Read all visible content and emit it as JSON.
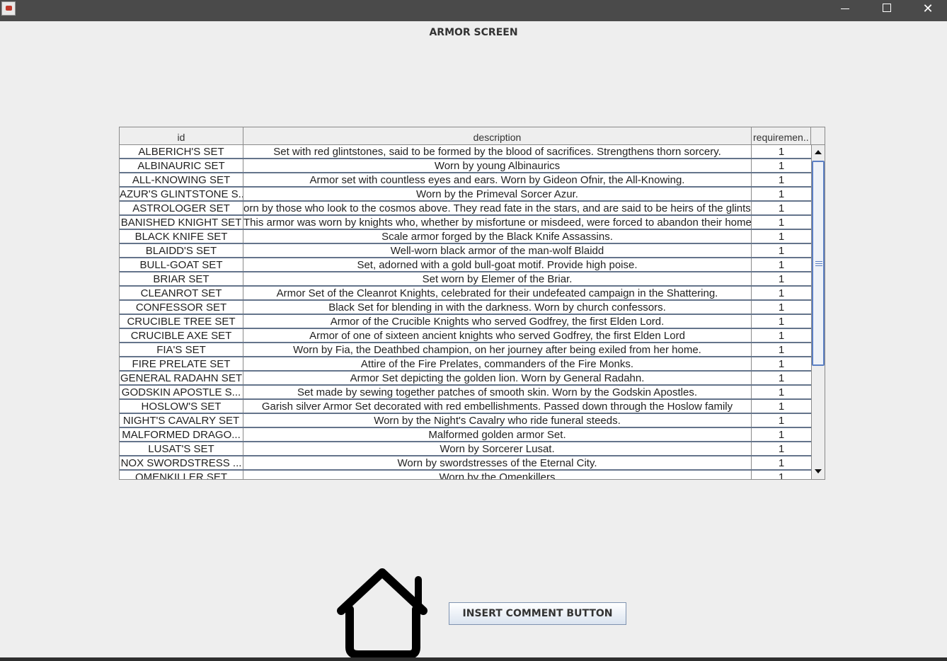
{
  "window": {
    "minimize_glyph": "",
    "maximize_glyph": "",
    "close_glyph": "✕"
  },
  "screen": {
    "title": "ARMOR SCREEN"
  },
  "table": {
    "columns": [
      "id",
      "description",
      "requiremen.."
    ],
    "rows": [
      {
        "id": "ALBERICH'S SET",
        "description": "Set with red glintstones, said to be formed by the blood of sacrifices. Strengthens thorn sorcery.",
        "req": "1"
      },
      {
        "id": "ALBINAURIC SET",
        "description": "Worn by young Albinaurics",
        "req": "1"
      },
      {
        "id": "ALL-KNOWING SET",
        "description": "Armor set with countless eyes and ears. Worn by Gideon Ofnir, the All-Knowing.",
        "req": "1"
      },
      {
        "id": "AZUR'S GLINTSTONE S...",
        "description": "Worn by the Primeval Sorcer Azur.",
        "req": "1"
      },
      {
        "id": "ASTROLOGER SET",
        "description": "orn by those who look to the cosmos above. They read fate in the stars, and are said to be heirs of the glintstone",
        "req": "1"
      },
      {
        "id": "BANISHED KNIGHT SET",
        "description": "This armor was worn by knights who, whether by misfortune or misdeed, were forced to abandon their homes.",
        "req": "1"
      },
      {
        "id": "BLACK KNIFE SET",
        "description": "Scale armor forged by the Black Knife Assassins.",
        "req": "1"
      },
      {
        "id": "BLAIDD'S SET",
        "description": "Well-worn black armor of the man-wolf Blaidd",
        "req": "1"
      },
      {
        "id": "BULL-GOAT SET",
        "description": "Set, adorned with a gold bull-goat motif. Provide high poise.",
        "req": "1"
      },
      {
        "id": "BRIAR SET",
        "description": "Set worn by Elemer of the Briar.",
        "req": "1"
      },
      {
        "id": "CLEANROT SET",
        "description": "Armor Set of the Cleanrot Knights, celebrated for their undefeated campaign in the Shattering.",
        "req": "1"
      },
      {
        "id": "CONFESSOR SET",
        "description": "Black Set for blending in with the darkness. Worn by church confessors.",
        "req": "1"
      },
      {
        "id": "CRUCIBLE TREE SET",
        "description": "Armor of the Crucible Knights who served Godfrey, the first Elden Lord.",
        "req": "1"
      },
      {
        "id": "CRUCIBLE AXE SET",
        "description": "Armor of one of sixteen ancient knights who served Godfrey, the first Elden Lord",
        "req": "1"
      },
      {
        "id": "FIA'S SET",
        "description": "Worn by Fia, the Deathbed champion, on her journey after being exiled from her home.",
        "req": "1"
      },
      {
        "id": "FIRE PRELATE SET",
        "description": "Attire of the Fire Prelates, commanders of the Fire Monks.",
        "req": "1"
      },
      {
        "id": "GENERAL RADAHN SET",
        "description": "Armor Set depicting the golden lion. Worn by General Radahn.",
        "req": "1"
      },
      {
        "id": "GODSKIN APOSTLE S...",
        "description": "Set made by sewing together patches of smooth skin. Worn by the Godskin Apostles.",
        "req": "1"
      },
      {
        "id": "HOSLOW'S SET",
        "description": "Garish silver Armor Set decorated with red embellishments. Passed down through the Hoslow family",
        "req": "1"
      },
      {
        "id": "NIGHT'S CAVALRY SET",
        "description": "Worn by the Night's Cavalry who ride funeral steeds.",
        "req": "1"
      },
      {
        "id": "MALFORMED DRAGO...",
        "description": "Malformed golden armor Set.",
        "req": "1"
      },
      {
        "id": "LUSAT'S SET",
        "description": "Worn by Sorcerer Lusat.",
        "req": "1"
      },
      {
        "id": "NOX SWORDSTRESS ...",
        "description": "Worn by swordstresses of the Eternal City.",
        "req": "1"
      },
      {
        "id": "OMENKILLER SET",
        "description": "Worn by the Omenkillers",
        "req": "1"
      }
    ]
  },
  "buttons": {
    "insert_comment": "INSERT COMMENT BUTTON"
  },
  "icons": {
    "home": "home-icon",
    "scroll_up": "arrow-up-icon",
    "scroll_down": "arrow-down-icon"
  }
}
